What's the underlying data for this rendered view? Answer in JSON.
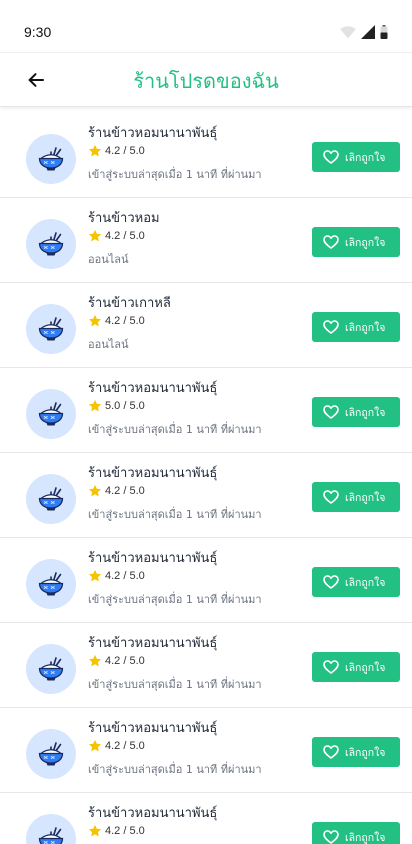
{
  "status_bar": {
    "time": "9:30"
  },
  "header": {
    "title": "ร้านโปรดของฉัน"
  },
  "colors": {
    "accent": "#22c083",
    "avatar_bg": "#d6e6ff",
    "star": "#f5c400"
  },
  "icons": {
    "back": "arrow-left-icon",
    "star": "star-icon",
    "heart": "heart-icon",
    "bowl": "rice-bowl-icon"
  },
  "items": [
    {
      "name": "ร้านข้าวหอมนานาพันธุ์",
      "rating": "4.2 / 5.0",
      "status": "เข้าสู่ระบบล่าสุดเมื่อ 1 นาที ที่ผ่านมา",
      "button": "เลิกถูกใจ"
    },
    {
      "name": "ร้านข้าวหอม",
      "rating": "4.2 / 5.0",
      "status": "ออนไลน์",
      "button": "เลิกถูกใจ"
    },
    {
      "name": "ร้านข้าวเกาหลี",
      "rating": "4.2 / 5.0",
      "status": "ออนไลน์",
      "button": "เลิกถูกใจ"
    },
    {
      "name": "ร้านข้าวหอมนานาพันธุ์",
      "rating": "5.0 / 5.0",
      "status": "เข้าสู่ระบบล่าสุดเมื่อ 1 นาที ที่ผ่านมา",
      "button": "เลิกถูกใจ"
    },
    {
      "name": "ร้านข้าวหอมนานาพันธุ์",
      "rating": "4.2 / 5.0",
      "status": "เข้าสู่ระบบล่าสุดเมื่อ 1 นาที ที่ผ่านมา",
      "button": "เลิกถูกใจ"
    },
    {
      "name": "ร้านข้าวหอมนานาพันธุ์",
      "rating": "4.2 / 5.0",
      "status": "เข้าสู่ระบบล่าสุดเมื่อ 1 นาที ที่ผ่านมา",
      "button": "เลิกถูกใจ"
    },
    {
      "name": "ร้านข้าวหอมนานาพันธุ์",
      "rating": "4.2 / 5.0",
      "status": "เข้าสู่ระบบล่าสุดเมื่อ 1 นาที ที่ผ่านมา",
      "button": "เลิกถูกใจ"
    },
    {
      "name": "ร้านข้าวหอมนานาพันธุ์",
      "rating": "4.2 / 5.0",
      "status": "เข้าสู่ระบบล่าสุดเมื่อ 1 นาที ที่ผ่านมา",
      "button": "เลิกถูกใจ"
    },
    {
      "name": "ร้านข้าวหอมนานาพันธุ์",
      "rating": "4.2 / 5.0",
      "status": "",
      "button": "เลิกถูกใจ"
    }
  ]
}
